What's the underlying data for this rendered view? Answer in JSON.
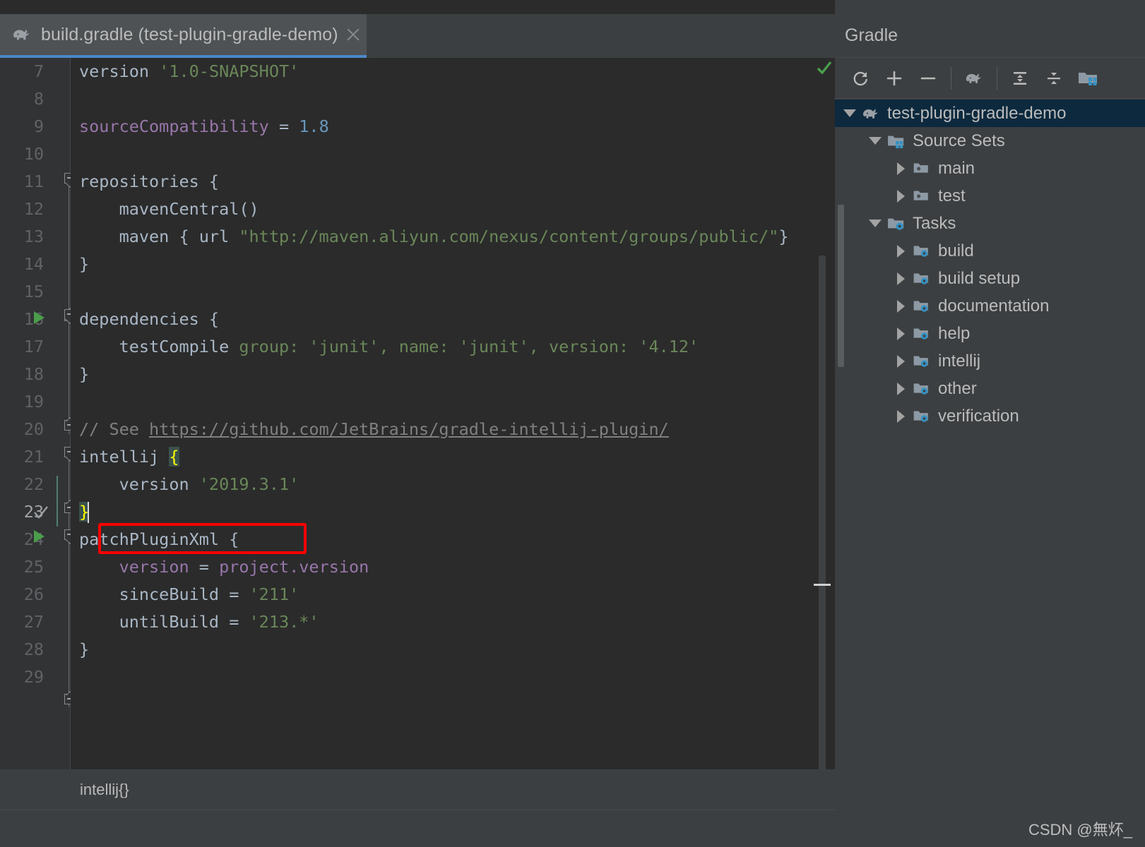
{
  "window": {
    "watermark": "CSDN @無炋_"
  },
  "editor_tab": {
    "title": "build.gradle (test-plugin-gradle-demo)",
    "icon": "gradle-elephant-icon",
    "close_icon": "close-icon",
    "active": true,
    "underline_color": "#4a88c7"
  },
  "editor": {
    "first_visible_line": 7,
    "current_line": 23,
    "caret_line": 23,
    "inspection_status": "ok",
    "lines": [
      {
        "n": 7,
        "text": "version '1.0-SNAPSHOT'"
      },
      {
        "n": 8,
        "text": ""
      },
      {
        "n": 9,
        "text": "sourceCompatibility = 1.8"
      },
      {
        "n": 10,
        "text": ""
      },
      {
        "n": 11,
        "text": "repositories {"
      },
      {
        "n": 12,
        "text": "    mavenCentral()"
      },
      {
        "n": 13,
        "text": "    maven { url \"http://maven.aliyun.com/nexus/content/groups/public/\"}"
      },
      {
        "n": 14,
        "text": "}"
      },
      {
        "n": 15,
        "text": ""
      },
      {
        "n": 16,
        "text": "dependencies {"
      },
      {
        "n": 17,
        "text": "    testCompile group: 'junit', name: 'junit', version: '4.12'"
      },
      {
        "n": 18,
        "text": "}"
      },
      {
        "n": 19,
        "text": ""
      },
      {
        "n": 20,
        "text": "// See https://github.com/JetBrains/gradle-intellij-plugin/"
      },
      {
        "n": 21,
        "text": "intellij {"
      },
      {
        "n": 22,
        "text": "    version '2019.3.1'"
      },
      {
        "n": 23,
        "text": "}"
      },
      {
        "n": 24,
        "text": "patchPluginXml {"
      },
      {
        "n": 25,
        "text": "    version = project.version"
      },
      {
        "n": 26,
        "text": "    sinceBuild = '211'"
      },
      {
        "n": 27,
        "text": "    untilBuild = '213.*'"
      },
      {
        "n": 28,
        "text": "}"
      },
      {
        "n": 29,
        "text": ""
      }
    ],
    "tokens": {
      "l7_kw": "version",
      "l7_str": "'1.0-SNAPSHOT'",
      "l9_prop": "sourceCompatibility",
      "l9_eq": " = ",
      "l9_num": "1.8",
      "l11": "repositories {",
      "l12": "    mavenCentral()",
      "l13_a": "    maven { url ",
      "l13_str": "\"http://maven.aliyun.com/nexus/content/groups/public/\"",
      "l13_b": "}",
      "l14": "}",
      "l16": "dependencies {",
      "l17_a": "    testCompile ",
      "l17_b": "group: 'junit', name: 'junit', version: '4.12'",
      "l18": "}",
      "l20_cmt": "// See ",
      "l20_url": "https://github.com/JetBrains/gradle-intellij-plugin/",
      "l21_a": "intellij ",
      "l21_brace": "{",
      "l22_a": "    version ",
      "l22_str": "'2019.3.1'",
      "l23_brace": "}",
      "l24": "patchPluginXml {",
      "l25_a": "    ",
      "l25_prop": "version",
      "l25_eq": " = ",
      "l25_ref": "project.version",
      "l26_a": "    sinceBuild = ",
      "l26_str": "'211'",
      "l27_a": "    untilBuild = ",
      "l27_str": "'213.*'",
      "l28": "}"
    },
    "annotation": {
      "shape": "rectangle",
      "color": "#ff0000",
      "surrounds": "version '2019.3.1'"
    },
    "run_markers": [
      16,
      24
    ],
    "breadcrumb": "intellij{}"
  },
  "gradle_panel": {
    "title": "Gradle",
    "toolbar": [
      {
        "name": "refresh-icon",
        "label": "Refresh all Gradle projects"
      },
      {
        "name": "plus-icon",
        "label": "Link Gradle Project"
      },
      {
        "name": "minus-icon",
        "label": "Detach Gradle Project"
      },
      {
        "name": "gradle-elephant-icon",
        "label": "Execute Gradle Task"
      },
      {
        "name": "expand-all-icon",
        "label": "Expand All"
      },
      {
        "name": "collapse-all-icon",
        "label": "Collapse All"
      },
      {
        "name": "module-folder-icon",
        "label": "Show Gradle Settings"
      }
    ],
    "tree": [
      {
        "label": "test-plugin-gradle-demo",
        "depth": 0,
        "expanded": true,
        "icon": "gradle-elephant-icon",
        "selected": true
      },
      {
        "label": "Source Sets",
        "depth": 1,
        "expanded": true,
        "icon": "source-sets-folder-icon",
        "selected": false
      },
      {
        "label": "main",
        "depth": 2,
        "expanded": false,
        "icon": "source-folder-icon",
        "selected": false
      },
      {
        "label": "test",
        "depth": 2,
        "expanded": false,
        "icon": "source-folder-icon",
        "selected": false
      },
      {
        "label": "Tasks",
        "depth": 1,
        "expanded": true,
        "icon": "tasks-folder-icon",
        "selected": false
      },
      {
        "label": "build",
        "depth": 2,
        "expanded": false,
        "icon": "tasks-folder-icon",
        "selected": false
      },
      {
        "label": "build setup",
        "depth": 2,
        "expanded": false,
        "icon": "tasks-folder-icon",
        "selected": false
      },
      {
        "label": "documentation",
        "depth": 2,
        "expanded": false,
        "icon": "tasks-folder-icon",
        "selected": false
      },
      {
        "label": "help",
        "depth": 2,
        "expanded": false,
        "icon": "tasks-folder-icon",
        "selected": false
      },
      {
        "label": "intellij",
        "depth": 2,
        "expanded": false,
        "icon": "tasks-folder-icon",
        "selected": false
      },
      {
        "label": "other",
        "depth": 2,
        "expanded": false,
        "icon": "tasks-folder-icon",
        "selected": false
      },
      {
        "label": "verification",
        "depth": 2,
        "expanded": false,
        "icon": "tasks-folder-icon",
        "selected": false
      }
    ]
  },
  "colors": {
    "bg_editor": "#2b2b2b",
    "bg_chrome": "#3c3f41",
    "bg_gutter": "#313335",
    "text_default": "#a9b7c6",
    "string": "#6a8759",
    "number": "#6897bb",
    "property": "#9876aa",
    "comment": "#808080",
    "selection": "#0d293e",
    "tab_underline": "#4a88c7",
    "annotation": "#ff0000",
    "brace_match": "#ffff00"
  }
}
